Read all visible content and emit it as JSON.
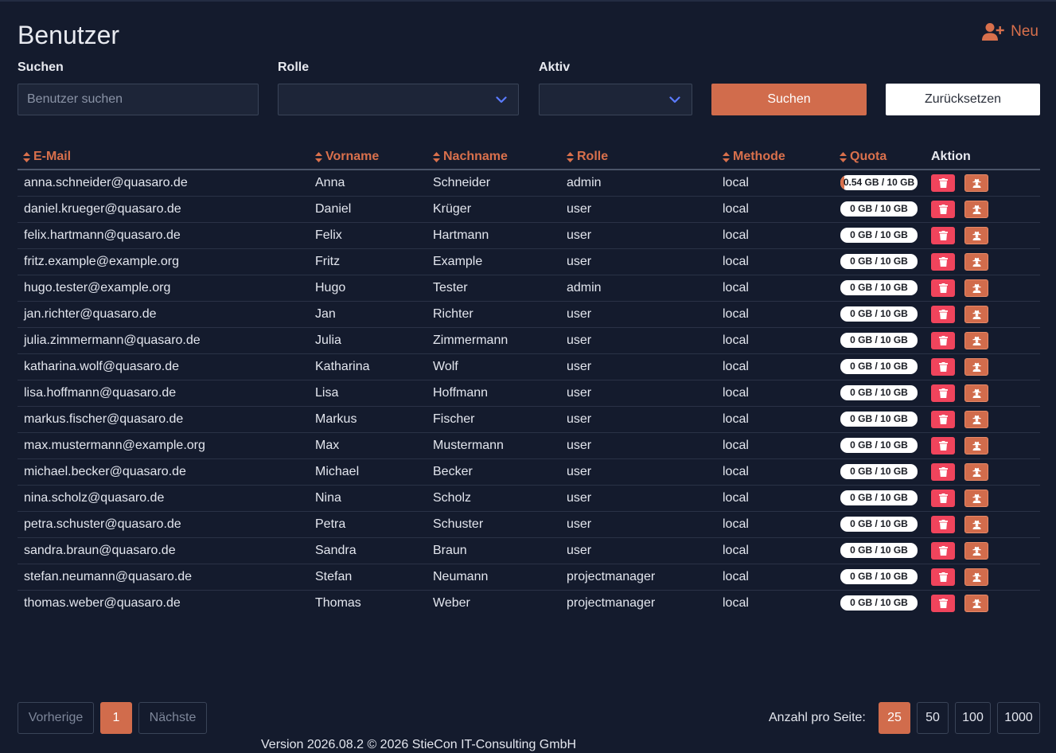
{
  "page": {
    "title": "Benutzer",
    "new_label": "Neu"
  },
  "filters": {
    "search_label": "Suchen",
    "search_placeholder": "Benutzer suchen",
    "role_label": "Rolle",
    "active_label": "Aktiv",
    "search_button": "Suchen",
    "reset_button": "Zurücksetzen"
  },
  "table": {
    "headers": {
      "email": "E-Mail",
      "firstname": "Vorname",
      "lastname": "Nachname",
      "role": "Rolle",
      "method": "Methode",
      "quota": "Quota",
      "action": "Aktion"
    },
    "rows": [
      {
        "email": "anna.schneider@quasaro.de",
        "firstname": "Anna",
        "lastname": "Schneider",
        "role": "admin",
        "method": "local",
        "quota": "0.54 GB / 10 GB",
        "quota_used": 0.054
      },
      {
        "email": "daniel.krueger@quasaro.de",
        "firstname": "Daniel",
        "lastname": "Krüger",
        "role": "user",
        "method": "local",
        "quota": "0 GB / 10 GB",
        "quota_used": 0
      },
      {
        "email": "felix.hartmann@quasaro.de",
        "firstname": "Felix",
        "lastname": "Hartmann",
        "role": "user",
        "method": "local",
        "quota": "0 GB / 10 GB",
        "quota_used": 0
      },
      {
        "email": "fritz.example@example.org",
        "firstname": "Fritz",
        "lastname": "Example",
        "role": "user",
        "method": "local",
        "quota": "0 GB / 10 GB",
        "quota_used": 0
      },
      {
        "email": "hugo.tester@example.org",
        "firstname": "Hugo",
        "lastname": "Tester",
        "role": "admin",
        "method": "local",
        "quota": "0 GB / 10 GB",
        "quota_used": 0
      },
      {
        "email": "jan.richter@quasaro.de",
        "firstname": "Jan",
        "lastname": "Richter",
        "role": "user",
        "method": "local",
        "quota": "0 GB / 10 GB",
        "quota_used": 0
      },
      {
        "email": "julia.zimmermann@quasaro.de",
        "firstname": "Julia",
        "lastname": "Zimmermann",
        "role": "user",
        "method": "local",
        "quota": "0 GB / 10 GB",
        "quota_used": 0
      },
      {
        "email": "katharina.wolf@quasaro.de",
        "firstname": "Katharina",
        "lastname": "Wolf",
        "role": "user",
        "method": "local",
        "quota": "0 GB / 10 GB",
        "quota_used": 0
      },
      {
        "email": "lisa.hoffmann@quasaro.de",
        "firstname": "Lisa",
        "lastname": "Hoffmann",
        "role": "user",
        "method": "local",
        "quota": "0 GB / 10 GB",
        "quota_used": 0
      },
      {
        "email": "markus.fischer@quasaro.de",
        "firstname": "Markus",
        "lastname": "Fischer",
        "role": "user",
        "method": "local",
        "quota": "0 GB / 10 GB",
        "quota_used": 0
      },
      {
        "email": "max.mustermann@example.org",
        "firstname": "Max",
        "lastname": "Mustermann",
        "role": "user",
        "method": "local",
        "quota": "0 GB / 10 GB",
        "quota_used": 0
      },
      {
        "email": "michael.becker@quasaro.de",
        "firstname": "Michael",
        "lastname": "Becker",
        "role": "user",
        "method": "local",
        "quota": "0 GB / 10 GB",
        "quota_used": 0
      },
      {
        "email": "nina.scholz@quasaro.de",
        "firstname": "Nina",
        "lastname": "Scholz",
        "role": "user",
        "method": "local",
        "quota": "0 GB / 10 GB",
        "quota_used": 0
      },
      {
        "email": "petra.schuster@quasaro.de",
        "firstname": "Petra",
        "lastname": "Schuster",
        "role": "user",
        "method": "local",
        "quota": "0 GB / 10 GB",
        "quota_used": 0
      },
      {
        "email": "sandra.braun@quasaro.de",
        "firstname": "Sandra",
        "lastname": "Braun",
        "role": "user",
        "method": "local",
        "quota": "0 GB / 10 GB",
        "quota_used": 0
      },
      {
        "email": "stefan.neumann@quasaro.de",
        "firstname": "Stefan",
        "lastname": "Neumann",
        "role": "projectmanager",
        "method": "local",
        "quota": "0 GB / 10 GB",
        "quota_used": 0
      },
      {
        "email": "thomas.weber@quasaro.de",
        "firstname": "Thomas",
        "lastname": "Weber",
        "role": "projectmanager",
        "method": "local",
        "quota": "0 GB / 10 GB",
        "quota_used": 0
      }
    ]
  },
  "pagination": {
    "prev": "Vorherige",
    "current": "1",
    "next": "Nächste"
  },
  "per_page": {
    "label": "Anzahl pro Seite:",
    "options": [
      "25",
      "50",
      "100",
      "1000"
    ],
    "selected": "25"
  },
  "footer": "Version 2026.08.2 © 2026 StieCon IT-Consulting GmbH",
  "colors": {
    "accent": "#d16c4c",
    "danger": "#f0445c",
    "background": "#141b2d",
    "select_chevron": "#5b7bff"
  },
  "icons": {
    "new": "user-plus-icon",
    "sort": "sort-icon",
    "delete": "trash-icon",
    "edit": "user-secret-icon",
    "dropdown": "chevron-down-icon"
  }
}
